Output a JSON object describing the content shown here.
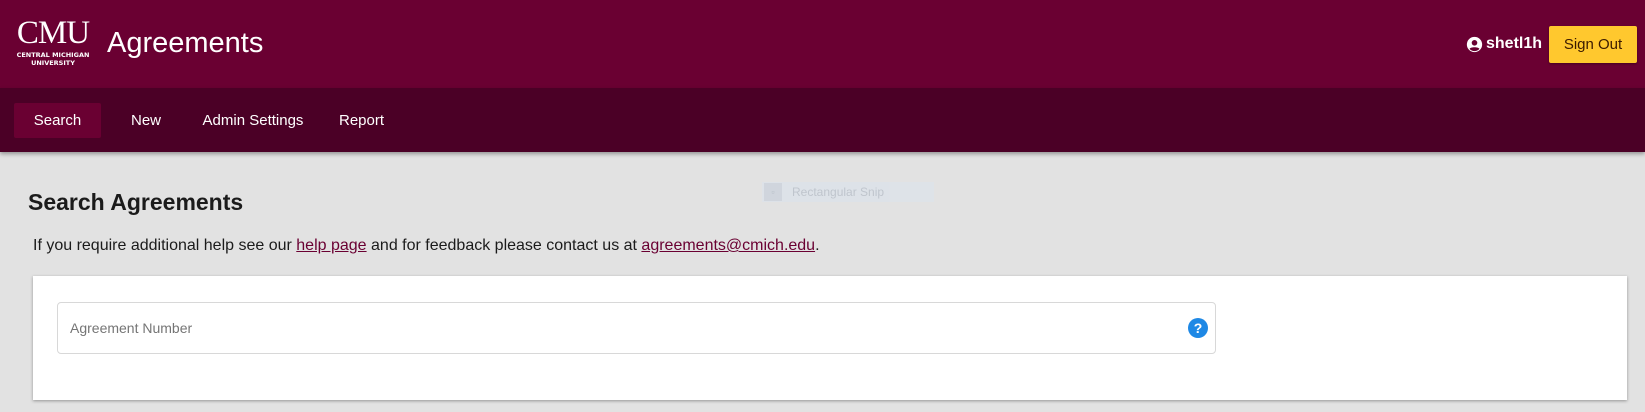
{
  "header": {
    "logo": {
      "mark": "CMU",
      "line1": "CENTRAL MICHIGAN",
      "line2": "UNIVERSITY"
    },
    "app_title": "Agreements",
    "user": {
      "icon": "account-circle-icon",
      "name": "shetl1h"
    },
    "signout_label": "Sign Out"
  },
  "nav": {
    "items": [
      {
        "label": "Search",
        "active": true
      },
      {
        "label": "New",
        "active": false
      },
      {
        "label": "Admin Settings",
        "active": false
      },
      {
        "label": "Report",
        "active": false
      }
    ]
  },
  "snip_overlay": {
    "label": "Rectangular Snip"
  },
  "main": {
    "title": "Search Agreements",
    "help": {
      "prefix": "If you require additional help see our ",
      "help_link": "help page",
      "middle": " and for feedback please contact us at ",
      "email_link": "agreements@cmich.edu",
      "suffix": "."
    },
    "agreement_field": {
      "placeholder": "Agreement Number",
      "value": "",
      "icon": "help-circle-icon",
      "icon_glyph": "?"
    }
  },
  "colors": {
    "brand_maroon": "#6a0032",
    "nav_maroon": "#4b0026",
    "accent_gold": "#ffc82e",
    "help_icon_blue": "#1e88e5",
    "page_background": "#e2e2e2"
  }
}
